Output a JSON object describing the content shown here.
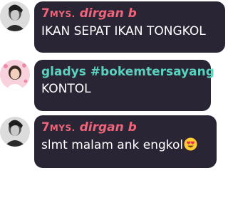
{
  "messages": [
    {
      "author_prefix": "7",
      "author_small": "MYS.",
      "author_name": "dirgan b",
      "author_color": "#f2637a",
      "text": "IKAN SEPAT IKAN TONGKOL",
      "avatar_icon": "profile-photo-icon"
    },
    {
      "author_prefix": "gladys",
      "author_small": "",
      "author_name": "#bokemtersayang",
      "author_color": "#5ad2be",
      "text": "KONTOL",
      "avatar_icon": "profile-photo-icon"
    },
    {
      "author_prefix": "7",
      "author_small": "MYS.",
      "author_name": "dirgan b",
      "author_color": "#f2637a",
      "text": "slmt malam ank engkol",
      "emoji": "heart-eyes-emoji-icon",
      "avatar_icon": "profile-photo-icon"
    }
  ],
  "colors": {
    "bubble": "#2a2535",
    "text": "#ffffff",
    "background": "#ffffff"
  }
}
